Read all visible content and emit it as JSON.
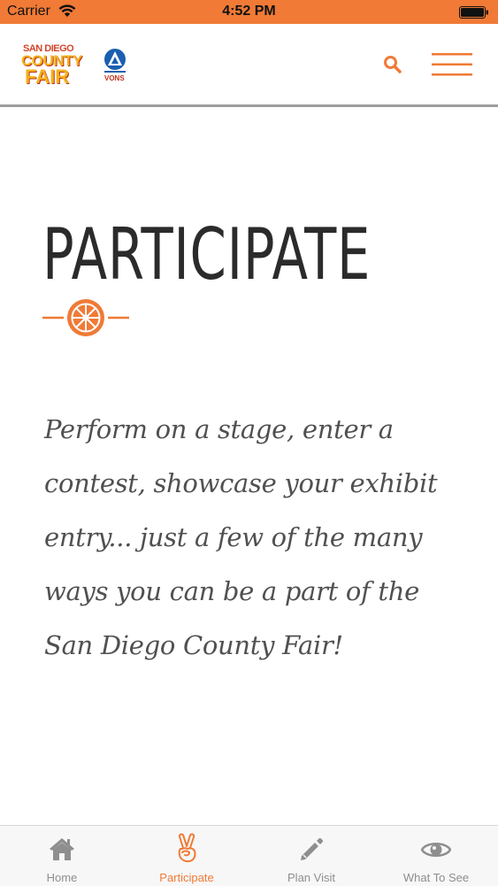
{
  "status_bar": {
    "carrier": "Carrier",
    "time": "4:52 PM"
  },
  "header": {
    "logo": {
      "line1": "SAN DIEGO",
      "line2": "COUNTY",
      "line3": "FAIR",
      "sponsor": "VONS"
    },
    "search_icon": "search-icon",
    "menu_icon": "hamburger-menu-icon"
  },
  "main": {
    "title": "PARTICIPATE",
    "divider_icon": "wagon-wheel-icon",
    "intro_lines": [
      "Perform on a stage, enter a",
      "contest, showcase your exhibit",
      "entry... just a few of the many",
      "ways you can be a part of the",
      "San Diego County Fair!"
    ]
  },
  "tab_bar": {
    "tabs": [
      {
        "label": "Home",
        "icon": "home-icon",
        "active": false
      },
      {
        "label": "Participate",
        "icon": "peace-hand-icon",
        "active": true
      },
      {
        "label": "Plan Visit",
        "icon": "pencil-icon",
        "active": false
      },
      {
        "label": "What To See",
        "icon": "eye-icon",
        "active": false
      }
    ]
  },
  "colors": {
    "accent": "#f07a36",
    "title": "#2b2b2b",
    "body_text": "#505050",
    "tab_inactive": "#8e8e8e"
  }
}
